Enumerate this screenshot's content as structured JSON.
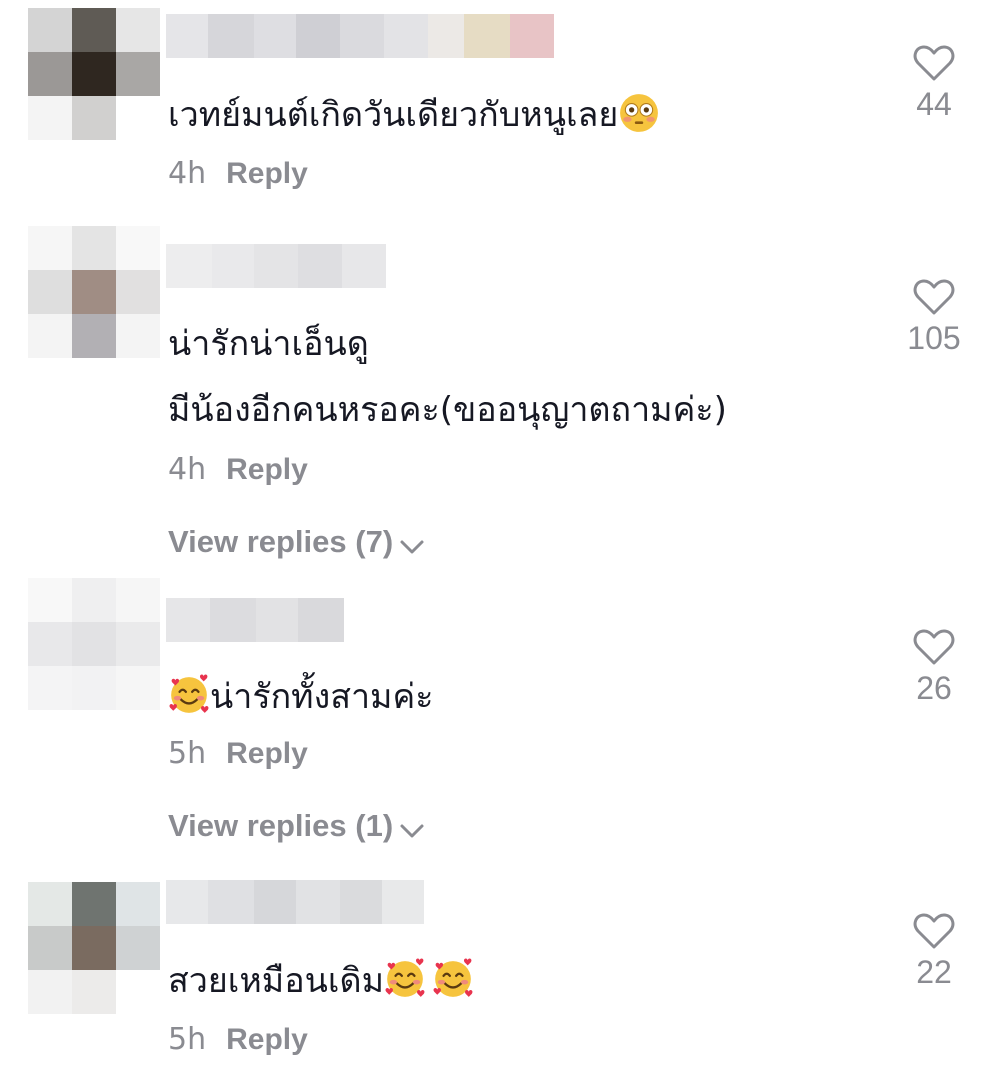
{
  "comments": [
    {
      "text": "เวทย์มนต์เกิดวันเดียวกับหนูเลย",
      "emoji": "flushed-face",
      "time": "4h",
      "reply": "Reply",
      "likes": "44",
      "avatar_colors": [
        "#d4d4d4",
        "#5f5b55",
        "#e6e6e6",
        "#9b9896",
        "#2f2720",
        "#a9a7a5",
        "#f4f4f4",
        "#d1d0cf",
        "#ffffff"
      ],
      "username_colors": [
        "#e5e5e8",
        "#d6d6da",
        "#dedee2",
        "#cfcfd4",
        "#dadade",
        "#e3e3e6",
        "#ece9e6",
        "#e6dcc4",
        "#e8c4c6"
      ]
    },
    {
      "line1": "น่ารักน่าเอ็นดู",
      "line2": "มีน้องอีกคนหรอคะ(ขออนุญาตถามค่ะ)",
      "time": "4h",
      "reply": "Reply",
      "likes": "105",
      "view_replies": "View replies (7)",
      "avatar_colors": [
        "#f6f6f6",
        "#e4e4e4",
        "#f8f8f8",
        "#dedede",
        "#a08d84",
        "#e1e0e0",
        "#f4f4f4",
        "#b2b0b4",
        "#f4f4f4"
      ],
      "username_colors": [
        "#ededee",
        "#e9e9eb",
        "#e4e4e6",
        "#dedee1",
        "#e7e7e9"
      ]
    },
    {
      "text": "น่ารักทั้งสามค่ะ",
      "emoji": "smiling-face-with-hearts",
      "time": "5h",
      "reply": "Reply",
      "likes": "26",
      "view_replies": "View replies (1)",
      "avatar_colors": [
        "#f8f8f8",
        "#efeff0",
        "#f6f6f6",
        "#e8e8ea",
        "#e2e2e4",
        "#eaeaeb",
        "#f4f4f5",
        "#f2f2f3",
        "#f6f6f6"
      ],
      "username_colors": [
        "#e6e6e8",
        "#dcdcdf",
        "#e2e2e4",
        "#d9d9dc"
      ]
    },
    {
      "text": "สวยเหมือนเดิม",
      "emoji": "smiling-face-with-hearts",
      "time": "5h",
      "reply": "Reply",
      "likes": "22",
      "avatar_colors": [
        "#e4e8e6",
        "#6f7470",
        "#dfe4e6",
        "#c8cac9",
        "#7a6b60",
        "#cfd2d3",
        "#f2f2f2",
        "#ecebea",
        "#ffffff"
      ],
      "username_colors": [
        "#e7e8ea",
        "#dfe0e3",
        "#d6d7da",
        "#e1e2e4",
        "#dadbdd",
        "#e8e9ea"
      ]
    }
  ]
}
